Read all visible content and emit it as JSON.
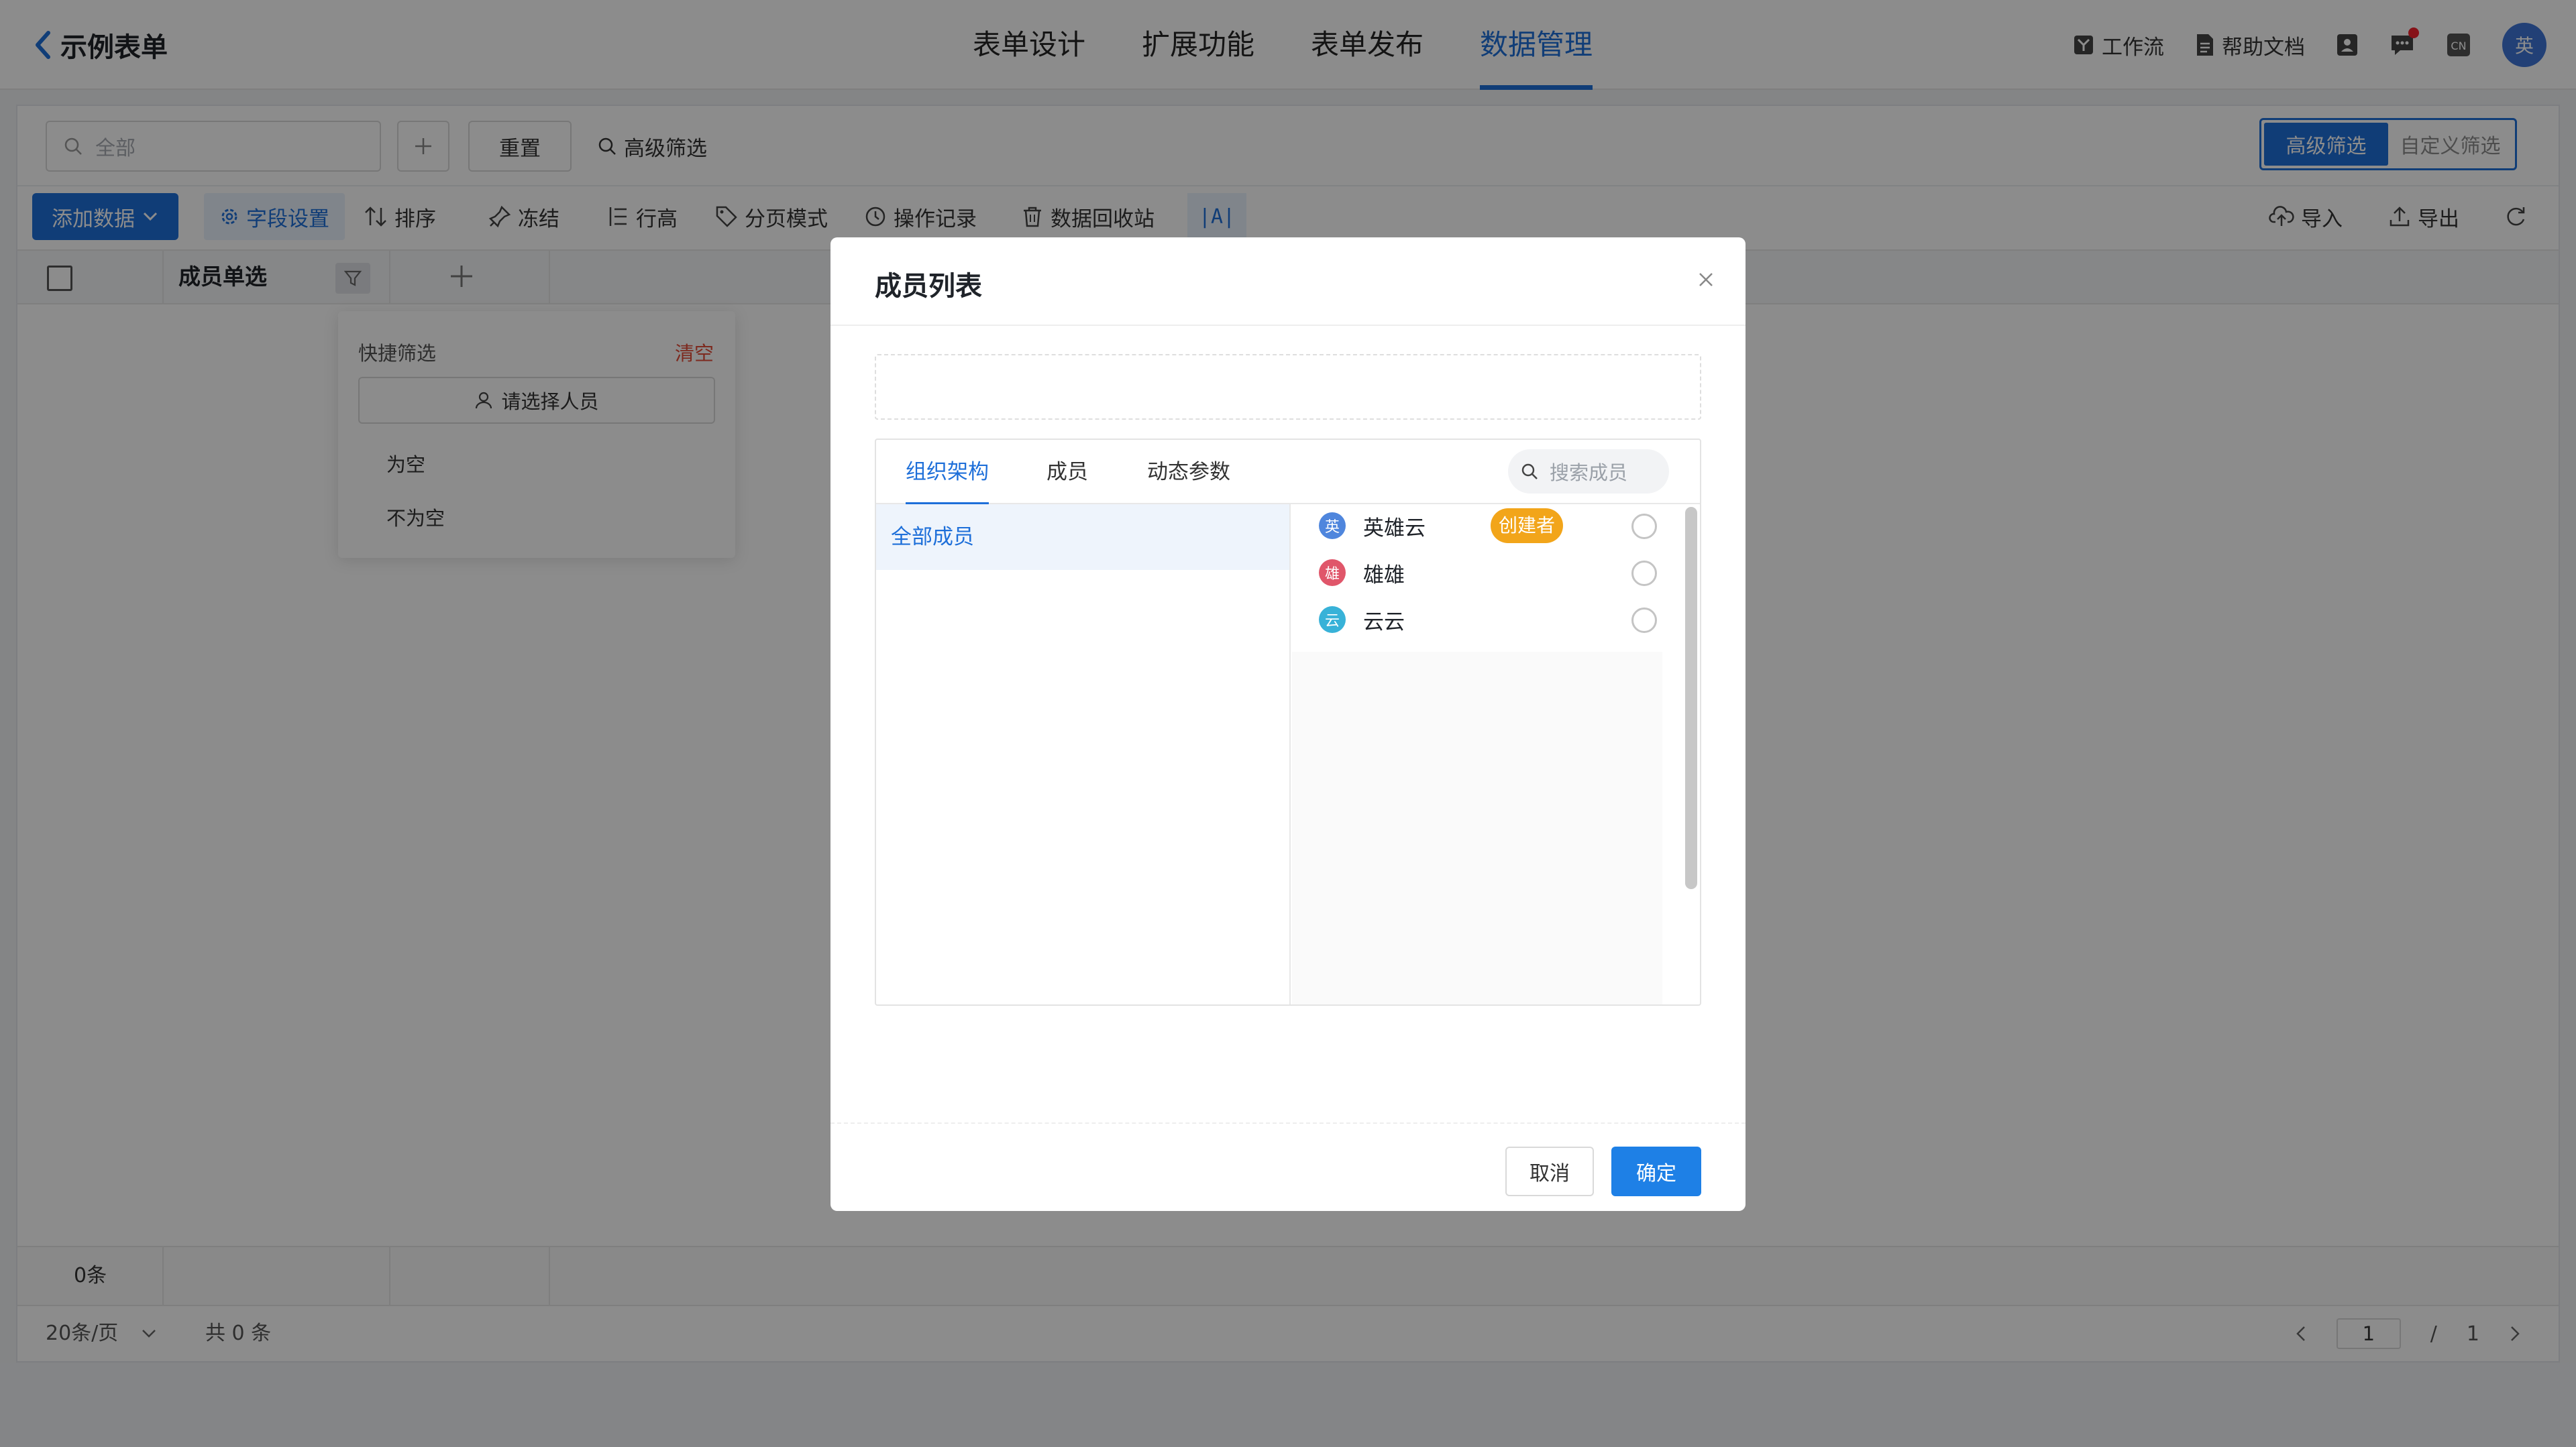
{
  "header": {
    "back_title": "示例表单",
    "nav": [
      "表单设计",
      "扩展功能",
      "表单发布",
      "数据管理"
    ],
    "active_nav": "数据管理",
    "workflow": "工作流",
    "help_docs": "帮助文档",
    "lang": "CN",
    "avatar": "英"
  },
  "filter": {
    "search_placeholder": "全部",
    "reset": "重置",
    "advanced": "高级筛选",
    "mode": [
      "高级筛选",
      "自定义筛选"
    ]
  },
  "toolbar": {
    "add": "添加数据",
    "field_settings": "字段设置",
    "sort": "排序",
    "freeze": "冻结",
    "row_height": "行高",
    "paging_mode": "分页模式",
    "op_log": "操作记录",
    "recycle": "数据回收站",
    "font": "|A|",
    "import": "导入",
    "export": "导出"
  },
  "table": {
    "column": "成员单选",
    "footer_count": "0条"
  },
  "popover": {
    "title": "快捷筛选",
    "clear": "清空",
    "select_placeholder": "请选择人员",
    "options": [
      "为空",
      "不为空"
    ]
  },
  "pager": {
    "page_size": "20条/页",
    "total": "共 0 条",
    "current": "1",
    "sep": "/",
    "pages": "1"
  },
  "modal": {
    "title": "成员列表",
    "tabs": [
      "组织架构",
      "成员",
      "动态参数"
    ],
    "search_placeholder": "搜索成员",
    "department": "全部成员",
    "members": [
      {
        "avatar": "英",
        "name": "英雄云",
        "badge": "创建者",
        "color": "#4f86dd"
      },
      {
        "avatar": "雄",
        "name": "雄雄",
        "badge": "",
        "color": "#e0566a"
      },
      {
        "avatar": "云",
        "name": "云云",
        "badge": "",
        "color": "#38b2d8"
      }
    ],
    "cancel": "取消",
    "ok": "确定"
  },
  "colors": {
    "accent": "#1e6fd9",
    "creator_badge": "#f2a51a",
    "clear": "#e34d3a"
  }
}
